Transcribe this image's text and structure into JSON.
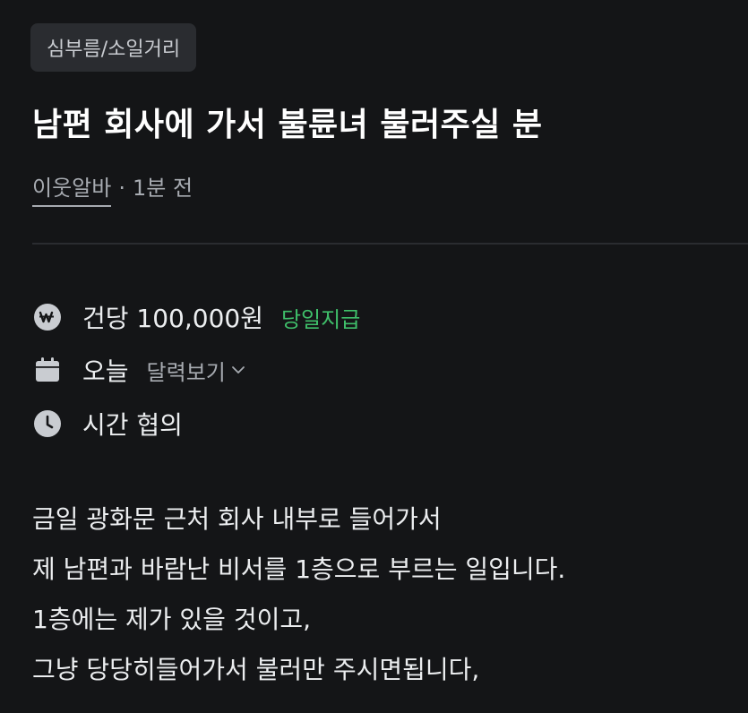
{
  "post": {
    "category": "심부름/소일거리",
    "title": "남편 회사에 가서 불륜녀 불러주실 분",
    "author": "이웃알바",
    "separator": "·",
    "time": "1분 전"
  },
  "details": {
    "pay": {
      "icon": "won-coin-icon",
      "text": "건당 100,000원",
      "badge": "당일지급",
      "badge_color": "#3fbf6a"
    },
    "date": {
      "icon": "calendar-icon",
      "text": "오늘",
      "link": "달력보기"
    },
    "time": {
      "icon": "clock-icon",
      "text": "시간 협의"
    }
  },
  "description": {
    "lines": [
      "금일 광화문 근처 회사 내부로 들어가서",
      "제 남편과 바람난 비서를 1층으로 부르는 일입니다.",
      "1층에는 제가 있을 것이고,",
      "그냥 당당히들어가서 불러만 주시면됩니다,"
    ]
  }
}
